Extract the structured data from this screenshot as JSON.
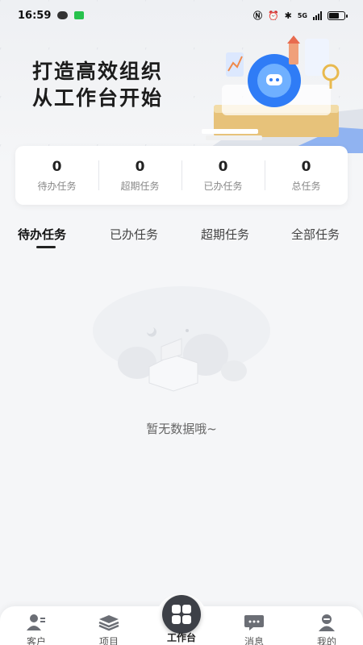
{
  "status_bar": {
    "time": "16:59",
    "network": "5G"
  },
  "hero": {
    "slogan_line1": "打造高效组织",
    "slogan_line2": "从工作台开始"
  },
  "stats": [
    {
      "value": "0",
      "label": "待办任务"
    },
    {
      "value": "0",
      "label": "超期任务"
    },
    {
      "value": "0",
      "label": "已办任务"
    },
    {
      "value": "0",
      "label": "总任务"
    }
  ],
  "tabs": [
    {
      "label": "待办任务",
      "active": true
    },
    {
      "label": "已办任务",
      "active": false
    },
    {
      "label": "超期任务",
      "active": false
    },
    {
      "label": "全部任务",
      "active": false
    }
  ],
  "empty_state": {
    "text": "暂无数据哦~"
  },
  "bottom_nav": {
    "items": [
      {
        "label": "客户",
        "icon": "customer-icon"
      },
      {
        "label": "项目",
        "icon": "project-icon"
      },
      {
        "label": "工作台",
        "icon": "workbench-icon",
        "active": true
      },
      {
        "label": "消息",
        "icon": "message-icon"
      },
      {
        "label": "我的",
        "icon": "profile-icon"
      }
    ]
  },
  "colors": {
    "background": "#f5f6f8",
    "card": "#ffffff",
    "accent_blue": "#2f7cf6",
    "nav_center": "#3d4047",
    "text_primary": "#222222",
    "text_secondary": "#888888"
  }
}
